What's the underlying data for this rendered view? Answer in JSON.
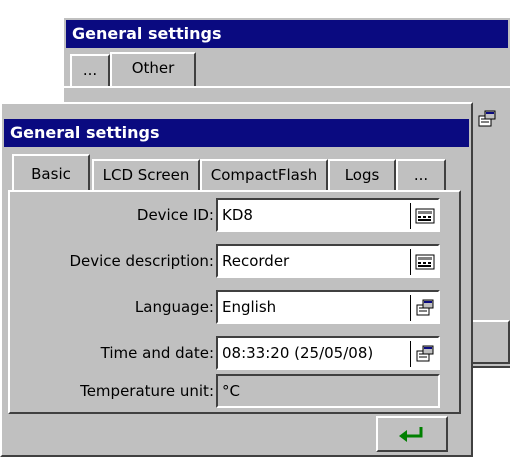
{
  "back_window": {
    "title": "General settings",
    "tabs": [
      {
        "label": "..."
      },
      {
        "label": "Other"
      }
    ]
  },
  "front_window": {
    "title": "General settings",
    "tabs": [
      {
        "label": "Basic"
      },
      {
        "label": "LCD Screen"
      },
      {
        "label": "CompactFlash"
      },
      {
        "label": "Logs"
      },
      {
        "label": "..."
      }
    ],
    "fields": [
      {
        "label": "Device ID:",
        "value": "KD8",
        "icon": "keyboard-icon"
      },
      {
        "label": "Device description:",
        "value": "Recorder",
        "icon": "keyboard-icon"
      },
      {
        "label": "Language:",
        "value": "English",
        "icon": "properties-icon"
      },
      {
        "label": "Time and date:",
        "value": "08:33:20 (25/05/08)",
        "icon": "properties-icon"
      },
      {
        "label": "Temperature unit:",
        "value": "°C"
      }
    ],
    "enter_icon": "enter-arrow-icon"
  },
  "colors": {
    "title_bar": "#0a0a80",
    "face": "#c0c0c0",
    "enter_arrow": "#008000"
  }
}
